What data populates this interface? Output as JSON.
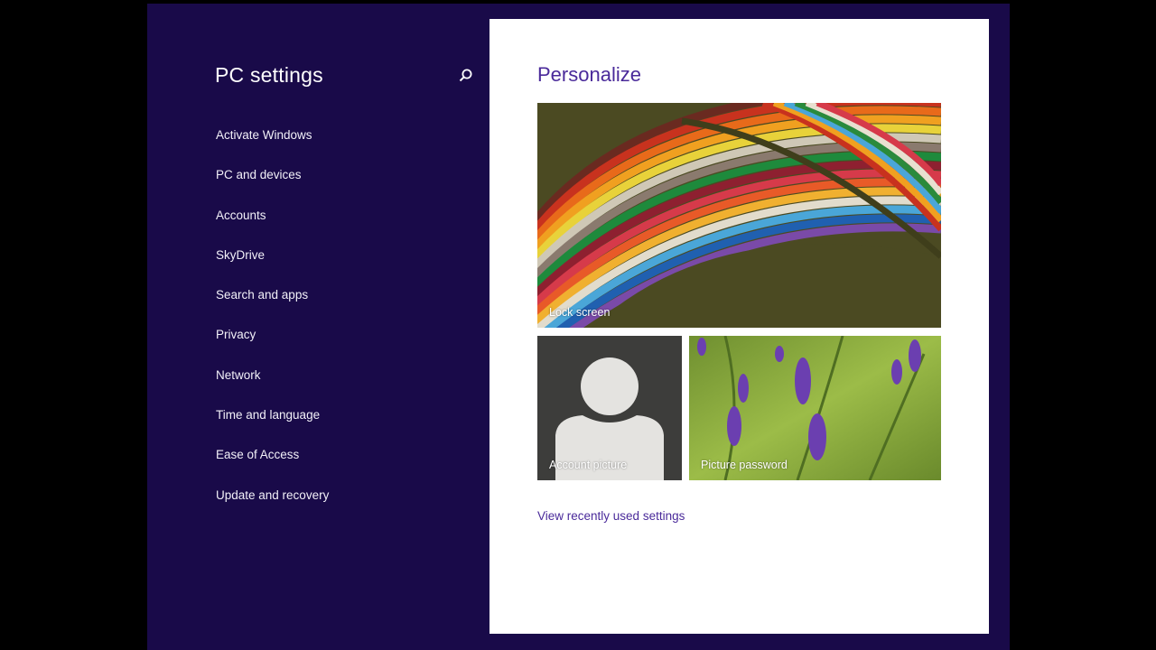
{
  "app": {
    "title": "PC settings"
  },
  "search": {
    "icon": "search-icon"
  },
  "sidebar": {
    "items": [
      {
        "label": "Activate Windows"
      },
      {
        "label": "PC and devices"
      },
      {
        "label": "Accounts"
      },
      {
        "label": "SkyDrive"
      },
      {
        "label": "Search and apps"
      },
      {
        "label": "Privacy"
      },
      {
        "label": "Network"
      },
      {
        "label": "Time and language"
      },
      {
        "label": "Ease of Access"
      },
      {
        "label": "Update and recovery"
      }
    ]
  },
  "main": {
    "title": "Personalize",
    "tiles": {
      "lock_screen": "Lock screen",
      "account_picture": "Account picture",
      "picture_password": "Picture password"
    },
    "recent_link": "View recently used settings"
  },
  "colors": {
    "sidebar_bg": "#190a49",
    "content_bg": "#ffffff",
    "accent": "#4a2a9a"
  }
}
